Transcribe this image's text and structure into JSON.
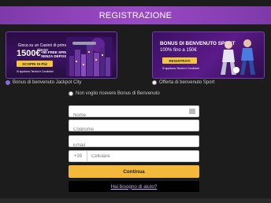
{
  "header": {
    "title": "REGISTRAZIONE"
  },
  "banner_casino": {
    "line1": "Gioca su un Casinò di prima classe",
    "amount": "1500€",
    "free_spins": "+50 FREE SPINS SENZA DEPOSITO",
    "button": "SCOPRI DI PIÙ",
    "terms": "Si applicano Termini e Condizioni"
  },
  "banner_sport": {
    "title": "BONUS DI BENVENUTO SPORT",
    "subtitle": "100% fino a 150€",
    "button": "REGISTRATI",
    "terms": "Si applicano Termini e Condizioni"
  },
  "options": {
    "casino_label": "Bonus di benvenuto Jackpot City",
    "sport_label": "Offerta di benvenuto Sport",
    "none_label": "Non voglio ricevere Bonus di Benvenuto"
  },
  "form": {
    "name_placeholder": "Nome",
    "surname_placeholder": "Cognome",
    "email_placeholder": "Email",
    "phone_prefix": "+39",
    "phone_placeholder": "Cellulare",
    "submit": "Continua",
    "help": "Hai bisogno di aiuto?"
  },
  "colors": {
    "header": "#8e44b8",
    "button": "#f4b93b",
    "link": "#c7a8f0",
    "background": "#1c1c1c"
  }
}
